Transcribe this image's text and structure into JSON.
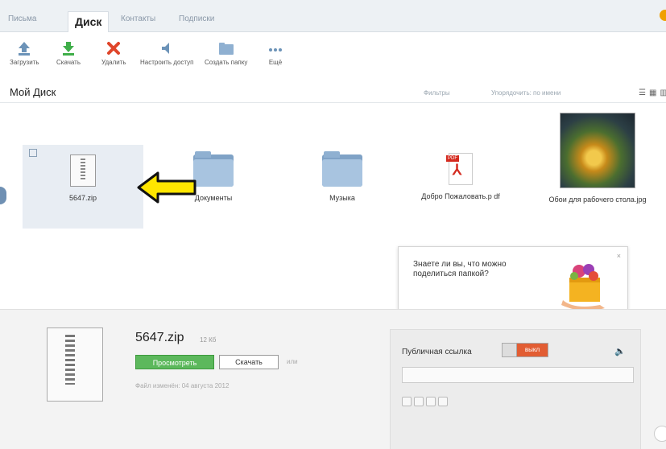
{
  "tabs": [
    "Письма",
    "Диск",
    "Контакты",
    "Подписки"
  ],
  "active_tab_index": 1,
  "toolbar": {
    "upload": "Загрузить",
    "download": "Скачать",
    "delete": "Удалить",
    "access": "Настроить доступ",
    "new_folder": "Создать папку",
    "more": "Ещё"
  },
  "header": {
    "title": "Мой Диск",
    "filters": "Фильтры",
    "sort": "Упорядочить: по имени"
  },
  "files": [
    {
      "name": "5647.zip",
      "kind": "zip-icon"
    },
    {
      "name": "Документы",
      "kind": "folder-icon"
    },
    {
      "name": "Музыка",
      "kind": "folder-icon"
    },
    {
      "name": "Добро Пожаловать.p df",
      "kind": "pdf-icon"
    },
    {
      "name": "Обои для рабочего стола.jpg",
      "kind": "image-thumbnail"
    }
  ],
  "tooltip": {
    "text": "Знаете ли вы, что можно поделиться папкой?",
    "close": "×"
  },
  "details": {
    "file_name": "5647.zip",
    "file_size": "12 Кб",
    "view_button": "Просмотреть",
    "download_button": "Скачать",
    "or_word": "или",
    "created": "Файл изменён: 04 августа 2012",
    "public_link_label": "Публичная ссылка",
    "switch_state": "выкл"
  },
  "colors": {
    "accent_green": "#5cb85c",
    "switch_off": "#e25d33",
    "folder_blue": "#a8c4e0",
    "arrow_yellow": "#ffe600"
  }
}
